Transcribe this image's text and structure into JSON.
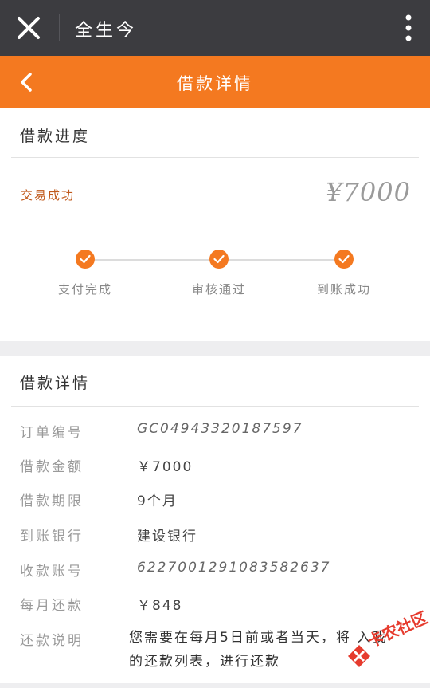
{
  "top_bar": {
    "title": "全生今",
    "close_icon": "close-icon",
    "more_icon": "more-vertical-icon"
  },
  "nav_bar": {
    "title": "借款详情",
    "back_icon": "chevron-left-icon"
  },
  "progress": {
    "section_title": "借款进度",
    "status": "交易成功",
    "amount": "¥7000",
    "steps": [
      {
        "label": "支付完成",
        "done": true
      },
      {
        "label": "审核通过",
        "done": true
      },
      {
        "label": "到账成功",
        "done": true
      }
    ]
  },
  "details": {
    "section_title": "借款详情",
    "rows": [
      {
        "label": "订单编号",
        "value": "GC04943320187597"
      },
      {
        "label": "借款金额",
        "value": "￥7000"
      },
      {
        "label": "借款期限",
        "value": "9个月"
      },
      {
        "label": "到账银行",
        "value": "建设银行"
      },
      {
        "label": "收款账号",
        "value": "6227001291083582637"
      },
      {
        "label": "每月还款",
        "value": "￥848"
      },
      {
        "label": "还款说明",
        "value": "您需要在每月5日前或者当天，将 入我的还款列表，进行还款"
      }
    ]
  },
  "watermark": {
    "text": "卡农社区"
  },
  "colors": {
    "accent": "#f47920",
    "topbar": "#3c3c40",
    "status": "#c0581a"
  }
}
